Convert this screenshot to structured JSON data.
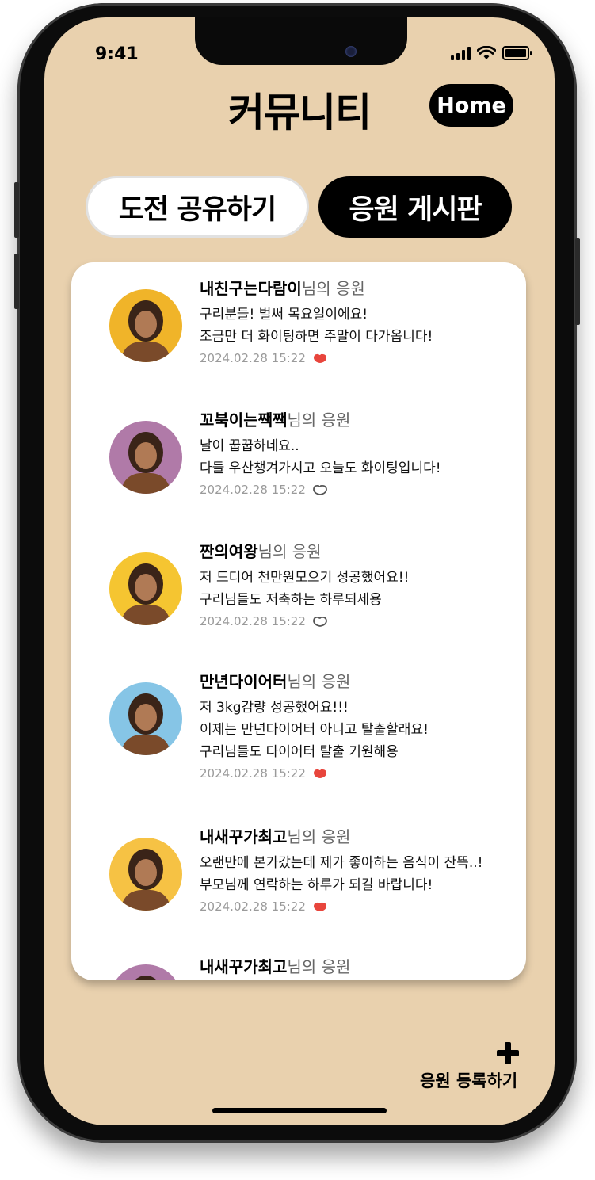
{
  "status_bar": {
    "time": "9:41"
  },
  "header": {
    "title": "커뮤니티",
    "home_label": "Home"
  },
  "tabs": [
    {
      "label": "도전 공유하기",
      "active": false
    },
    {
      "label": "응원 게시판",
      "active": true
    }
  ],
  "posts": [
    {
      "author": "내친구는다람이",
      "suffix": "님의 응원",
      "lines": [
        "구리분들! 벌써 목요일이에요!",
        "조금만 더 화이팅하면 주말이 다가옵니다!"
      ],
      "date": "2024.02.28 15:22",
      "liked": true,
      "avatar_bg": "#f0b429"
    },
    {
      "author": "꼬북이는짹짹",
      "suffix": "님의 응원",
      "lines": [
        "날이 꿉꿉하네요..",
        "다들 우산챙겨가시고 오늘도 화이팅입니다!"
      ],
      "date": "2024.02.28 15:22",
      "liked": false,
      "avatar_bg": "#b07aa8"
    },
    {
      "author": "짠의여왕",
      "suffix": "님의 응원",
      "lines": [
        "저 드디어 천만원모으기 성공했어요!!",
        "구리님들도 저축하는 하루되세용"
      ],
      "date": "2024.02.28 15:22",
      "liked": false,
      "avatar_bg": "#f5c531"
    },
    {
      "author": "만년다이어터",
      "suffix": "님의 응원",
      "lines": [
        "저 3kg감량 성공했어요!!!",
        "이제는 만년다이어터 아니고 탈출할래요!",
        "구리님들도 다이어터 탈출 기원해용"
      ],
      "date": "2024.02.28 15:22",
      "liked": true,
      "avatar_bg": "#86c5e6"
    },
    {
      "author": "내새꾸가최고",
      "suffix": "님의 응원",
      "lines": [
        "오랜만에 본가갔는데 제가 좋아하는 음식이 잔뜩..!",
        "부모님께 연락하는 하루가 되길 바랍니다!"
      ],
      "date": "2024.02.28 15:22",
      "liked": true,
      "avatar_bg": "#f6c244"
    },
    {
      "author": "내새꾸가최고",
      "suffix": "님의 응원",
      "lines": [],
      "date": "",
      "liked": false,
      "avatar_bg": "#b07aa8"
    }
  ],
  "footer": {
    "add_label": "응원 등록하기"
  },
  "colors": {
    "screen_bg": "#e9d1ae",
    "accent_heart": "#e8453c",
    "dark": "#000000"
  }
}
